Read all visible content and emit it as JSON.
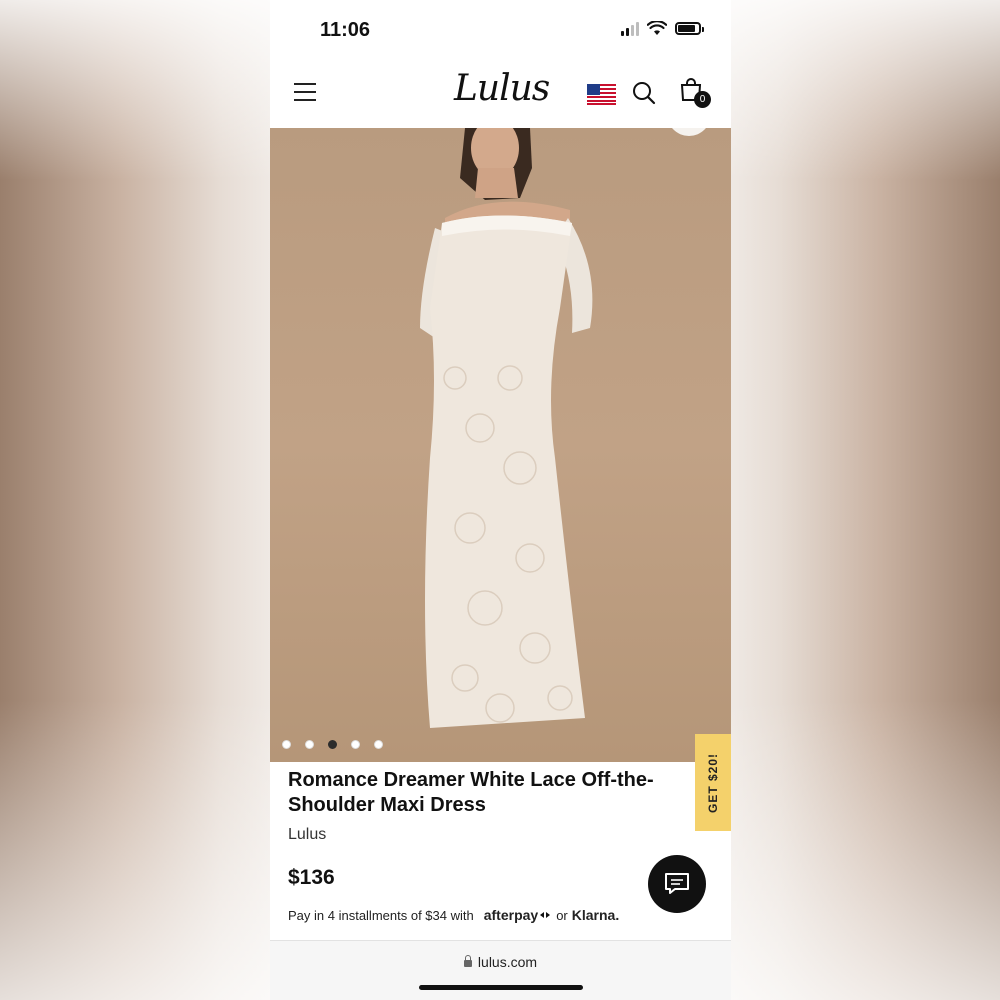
{
  "status_bar": {
    "time": "11:06"
  },
  "nav": {
    "logo": "Lulus",
    "cart_count": "0"
  },
  "product": {
    "title": "Romance Dreamer White Lace Off-the-Shoulder Maxi Dress",
    "brand": "Lulus",
    "price": "$136",
    "image_count": 5,
    "active_image_index": 2
  },
  "installments": {
    "text": "Pay in 4 installments of $34 with",
    "afterpay": "afterpay",
    "or": "or",
    "klarna": "Klarna."
  },
  "promo": {
    "label": "GET $20!"
  },
  "browser": {
    "url": "lulus.com"
  },
  "icons": [
    "menu-icon",
    "flag-us-icon",
    "search-icon",
    "shopping-bag-icon",
    "chat-icon",
    "lock-icon"
  ],
  "colors": {
    "promo": "#f4d16b",
    "image_bg": "#bfa084",
    "text": "#111111"
  }
}
